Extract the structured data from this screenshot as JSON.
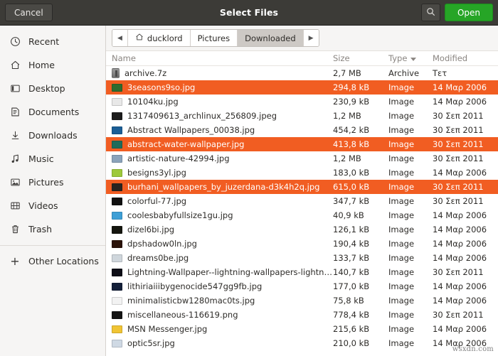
{
  "header": {
    "title": "Select Files",
    "cancel_label": "Cancel",
    "open_label": "Open",
    "search_icon": "search-icon",
    "open_color": "#26a526",
    "bar_color": "#3c3b37"
  },
  "sidebar": {
    "items": [
      {
        "label": "Recent",
        "icon": "clock-icon"
      },
      {
        "label": "Home",
        "icon": "home-icon"
      },
      {
        "label": "Desktop",
        "icon": "desktop-icon"
      },
      {
        "label": "Documents",
        "icon": "documents-icon"
      },
      {
        "label": "Downloads",
        "icon": "download-icon"
      },
      {
        "label": "Music",
        "icon": "music-note-icon"
      },
      {
        "label": "Pictures",
        "icon": "picture-icon"
      },
      {
        "label": "Videos",
        "icon": "video-icon"
      },
      {
        "label": "Trash",
        "icon": "trash-icon"
      }
    ],
    "other_locations": {
      "label": "Other Locations",
      "icon": "plus-icon"
    }
  },
  "pathbar": {
    "back_icon": "chevron-left-icon",
    "forward_icon": "chevron-right-icon",
    "crumbs": [
      {
        "label": "ducklord",
        "icon": "home-icon",
        "active": false
      },
      {
        "label": "Pictures",
        "icon": "",
        "active": false
      },
      {
        "label": "Downloaded",
        "icon": "",
        "active": true
      }
    ]
  },
  "columns": {
    "name": "Name",
    "size": "Size",
    "type": "Type",
    "modified": "Modified",
    "sort_icon": "chevron-down-icon",
    "sorted_by": "Type"
  },
  "selection_color": "#f15d22",
  "files": [
    {
      "name": "archive.7z",
      "size": "2,7 MB",
      "type": "Archive",
      "modified": "Τετ",
      "selected": false,
      "icon": "archive-file-icon",
      "thumb": "#8a8a8a"
    },
    {
      "name": "3seasons9so.jpg",
      "size": "294,8 kB",
      "type": "Image",
      "modified": "14 Μαρ 2006",
      "selected": true,
      "icon": "image-thumbnail",
      "thumb": "#2e6b2e"
    },
    {
      "name": "10104ku.jpg",
      "size": "230,9 kB",
      "type": "Image",
      "modified": "14 Μαρ 2006",
      "selected": false,
      "icon": "image-thumbnail",
      "thumb": "#e8e8e8"
    },
    {
      "name": "1317409613_archlinux_256809.jpeg",
      "size": "1,2 MB",
      "type": "Image",
      "modified": "30 Σεπ 2011",
      "selected": false,
      "icon": "image-thumbnail",
      "thumb": "#1c1c1c"
    },
    {
      "name": "Abstract Wallpapers_00038.jpg",
      "size": "454,2 kB",
      "type": "Image",
      "modified": "30 Σεπ 2011",
      "selected": false,
      "icon": "image-thumbnail",
      "thumb": "#1b5e96"
    },
    {
      "name": "abstract-water-wallpaper.jpg",
      "size": "413,8 kB",
      "type": "Image",
      "modified": "30 Σεπ 2011",
      "selected": true,
      "icon": "image-thumbnail",
      "thumb": "#1e6b5a"
    },
    {
      "name": "artistic-nature-42994.jpg",
      "size": "1,2 MB",
      "type": "Image",
      "modified": "30 Σεπ 2011",
      "selected": false,
      "icon": "image-thumbnail",
      "thumb": "#8ba3bb"
    },
    {
      "name": "besigns3yl.jpg",
      "size": "183,0 kB",
      "type": "Image",
      "modified": "14 Μαρ 2006",
      "selected": false,
      "icon": "image-thumbnail",
      "thumb": "#9ec93a"
    },
    {
      "name": "burhani_wallpapers_by_juzerdana-d3k4h2q.jpg",
      "size": "615,0 kB",
      "type": "Image",
      "modified": "30 Σεπ 2011",
      "selected": true,
      "icon": "image-thumbnail",
      "thumb": "#2a2420"
    },
    {
      "name": "colorful-77.jpg",
      "size": "347,7 kB",
      "type": "Image",
      "modified": "30 Σεπ 2011",
      "selected": false,
      "icon": "image-thumbnail",
      "thumb": "#111111"
    },
    {
      "name": "coolesbabyfullsize1gu.jpg",
      "size": "40,9 kB",
      "type": "Image",
      "modified": "14 Μαρ 2006",
      "selected": false,
      "icon": "image-thumbnail",
      "thumb": "#3d9fd6"
    },
    {
      "name": "dizel6bi.jpg",
      "size": "126,1 kB",
      "type": "Image",
      "modified": "14 Μαρ 2006",
      "selected": false,
      "icon": "image-thumbnail",
      "thumb": "#15160f"
    },
    {
      "name": "dpshadow0ln.jpg",
      "size": "190,4 kB",
      "type": "Image",
      "modified": "14 Μαρ 2006",
      "selected": false,
      "icon": "image-thumbnail",
      "thumb": "#2a1208"
    },
    {
      "name": "dreams0be.jpg",
      "size": "133,7 kB",
      "type": "Image",
      "modified": "14 Μαρ 2006",
      "selected": false,
      "icon": "image-thumbnail",
      "thumb": "#cfd6dc"
    },
    {
      "name": "Lightning-Wallpaper--lightning-wallpapers-lightni…",
      "size": "140,7 kB",
      "type": "Image",
      "modified": "30 Σεπ 2011",
      "selected": false,
      "icon": "image-thumbnail",
      "thumb": "#0d0d16"
    },
    {
      "name": "lithiriaiiibygenocide547gg9fb.jpg",
      "size": "177,0 kB",
      "type": "Image",
      "modified": "14 Μαρ 2006",
      "selected": false,
      "icon": "image-thumbnail",
      "thumb": "#14203a"
    },
    {
      "name": "minimalisticbw1280mac0ts.jpg",
      "size": "75,8 kB",
      "type": "Image",
      "modified": "14 Μαρ 2006",
      "selected": false,
      "icon": "image-thumbnail",
      "thumb": "#f2f2f2"
    },
    {
      "name": "miscellaneous-116619.png",
      "size": "778,4 kB",
      "type": "Image",
      "modified": "30 Σεπ 2011",
      "selected": false,
      "icon": "image-thumbnail",
      "thumb": "#141414"
    },
    {
      "name": "MSN Messenger.jpg",
      "size": "215,6 kB",
      "type": "Image",
      "modified": "14 Μαρ 2006",
      "selected": false,
      "icon": "image-thumbnail",
      "thumb": "#f0c434"
    },
    {
      "name": "optic5sr.jpg",
      "size": "210,0 kB",
      "type": "Image",
      "modified": "14 Μαρ 2006",
      "selected": false,
      "icon": "image-thumbnail",
      "thumb": "#cfd9e4"
    }
  ],
  "watermark": "wsxdn.com"
}
